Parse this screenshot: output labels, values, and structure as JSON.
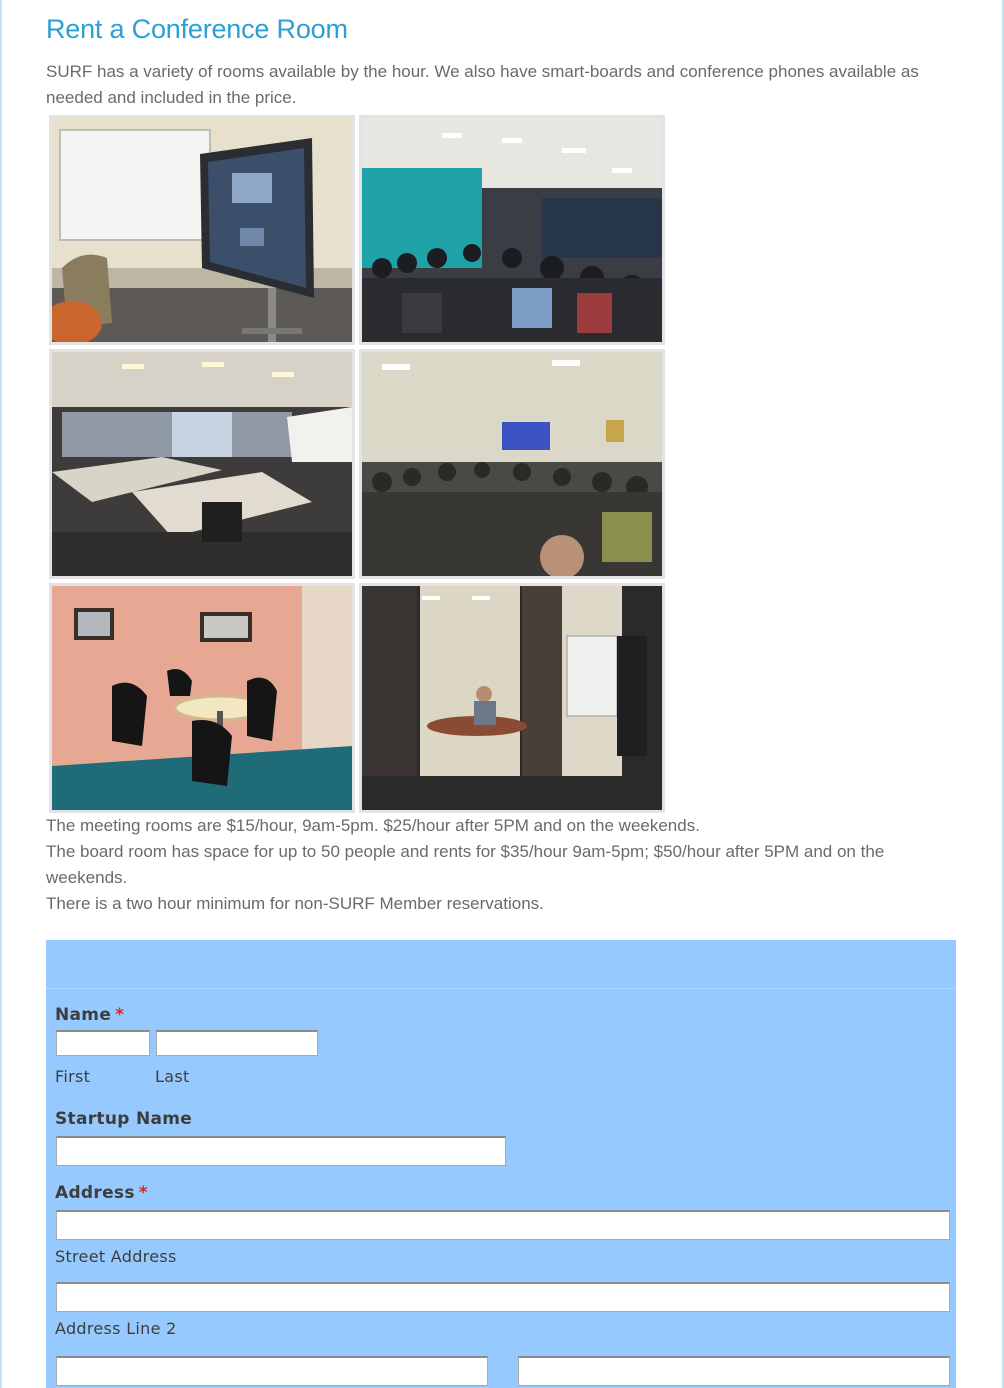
{
  "page": {
    "title": "Rent a Conference Room",
    "intro": "SURF has a variety of rooms available by the hour. We also have smart-boards and conference phones available as needed and included in the price."
  },
  "gallery": [
    {
      "name": "photo-smartboard-room"
    },
    {
      "name": "photo-audience-teal-wall"
    },
    {
      "name": "photo-empty-classroom"
    },
    {
      "name": "photo-presentation-audience"
    },
    {
      "name": "photo-pink-meeting-room"
    },
    {
      "name": "photo-doorway-meeting"
    }
  ],
  "pricing": {
    "line1": "The meeting rooms are $15/hour, 9am-5pm. $25/hour after 5PM and on the weekends.",
    "line2": "The board room has space for up to 50 people and rents for $35/hour 9am-5pm; $50/hour after 5PM and on the weekends.",
    "line3": "There is a two hour minimum for non-SURF Member reservations."
  },
  "form": {
    "name_label": "Name",
    "required_mark": "*",
    "first_label": "First",
    "last_label": "Last",
    "startup_label": "Startup Name",
    "address_label": "Address",
    "street_label": "Street Address",
    "line2_label": "Address Line 2",
    "first_value": "",
    "last_value": "",
    "startup_value": "",
    "street_value": "",
    "line2_value": "",
    "city_value": "",
    "state_value": ""
  },
  "colors": {
    "title": "#2e9fd6",
    "form_background": "#96caff",
    "required": "#d42a2a"
  }
}
